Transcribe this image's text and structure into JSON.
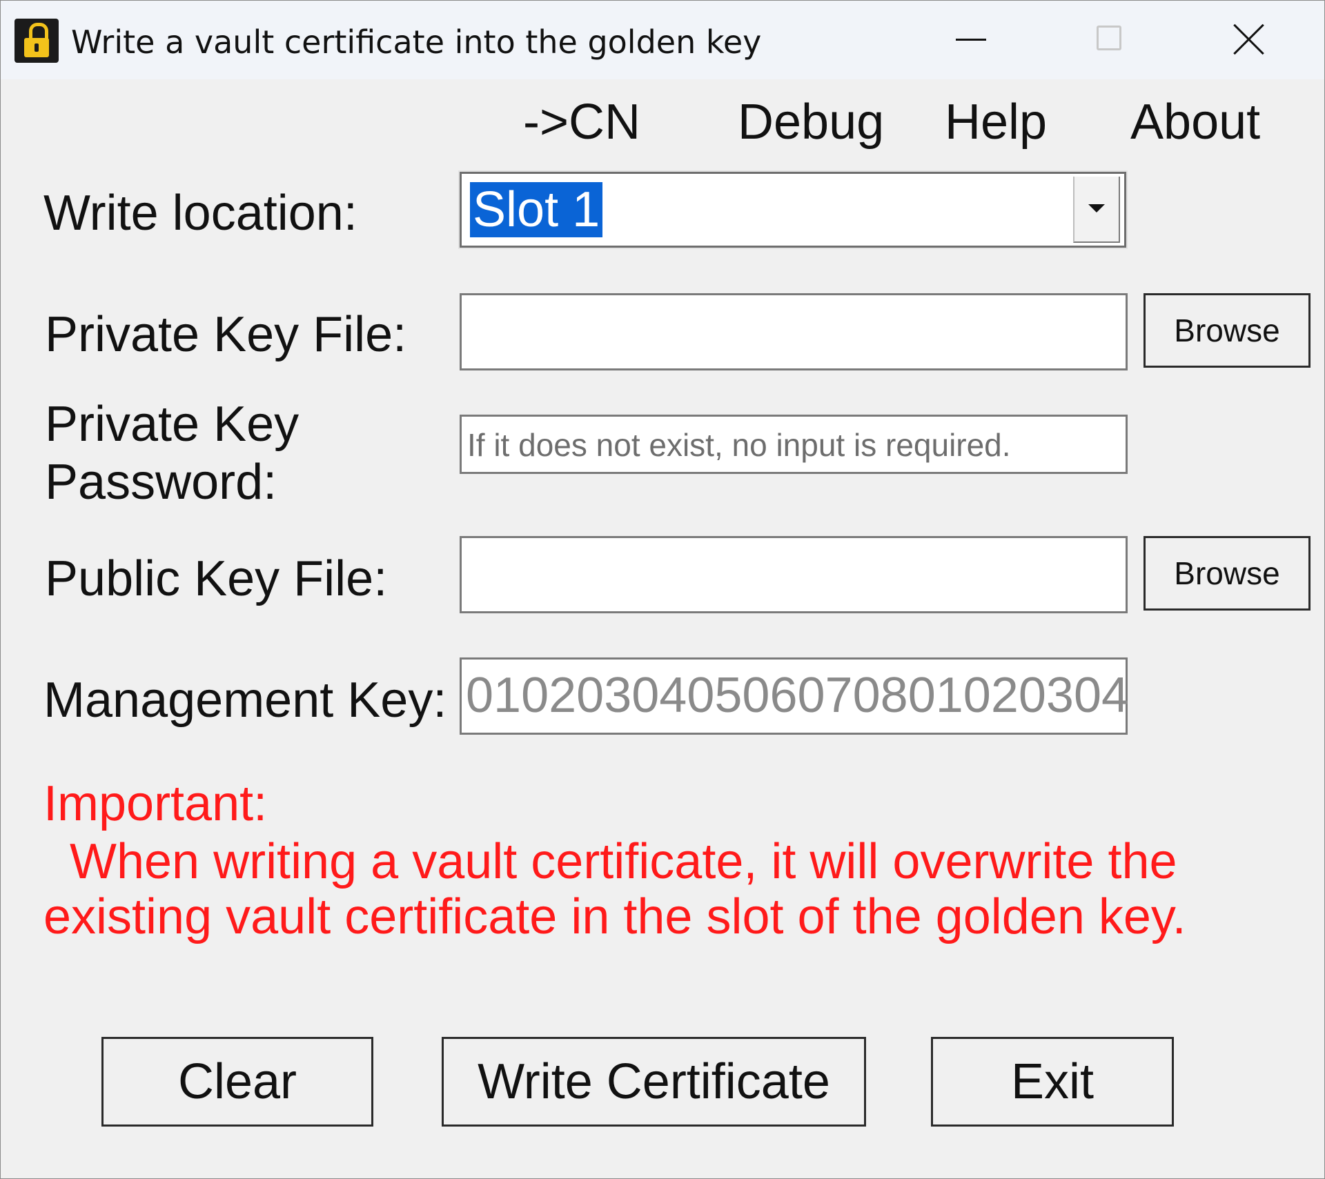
{
  "window": {
    "title": "Write a vault certificate into the golden key",
    "icon": "lock-icon"
  },
  "menu": {
    "items": [
      "->CN",
      "Debug",
      "Help",
      "About"
    ]
  },
  "form": {
    "write_location": {
      "label": "Write location:",
      "value": "Slot 1"
    },
    "private_key_file": {
      "label": "Private Key File:",
      "value": "",
      "browse_label": "Browse"
    },
    "private_key_password": {
      "label_line1": "Private Key",
      "label_line2": "Password:",
      "placeholder": "If it does not exist, no input is required."
    },
    "public_key_file": {
      "label": "Public Key File:",
      "value": "",
      "browse_label": "Browse"
    },
    "management_key": {
      "label": "Management Key:",
      "value": "010203040506070801020304"
    }
  },
  "warning": {
    "heading": "Important:",
    "line1": "When writing a vault certificate, it will overwrite the",
    "line2": "existing vault certificate in the slot of the golden key.",
    "color": "#ff1a1a"
  },
  "actions": {
    "clear": "Clear",
    "write": "Write Certificate",
    "exit": "Exit"
  }
}
